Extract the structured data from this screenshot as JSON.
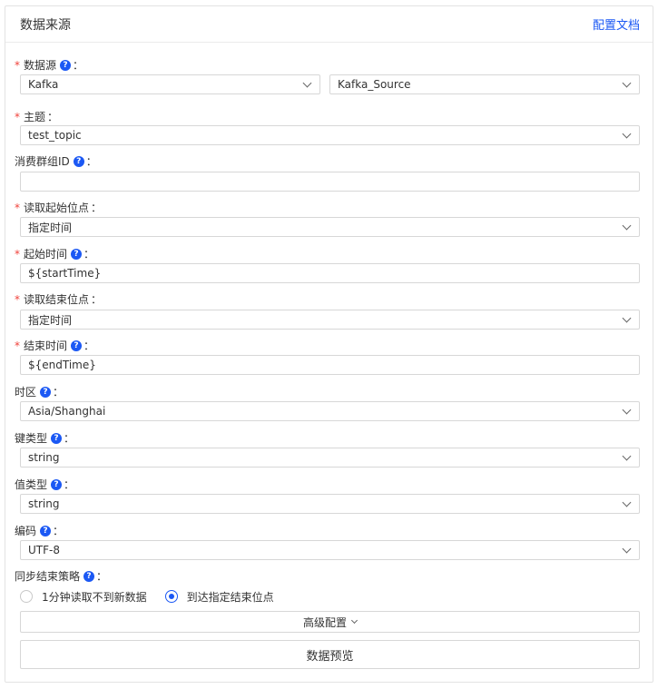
{
  "panel": {
    "title": "数据来源",
    "doc_link": "配置文档"
  },
  "fields": {
    "datasource": {
      "label": "数据源",
      "type_value": "Kafka",
      "source_value": "Kafka_Source"
    },
    "topic": {
      "label": "主题",
      "value": "test_topic"
    },
    "consumer_group": {
      "label": "消费群组ID",
      "value": ""
    },
    "read_start": {
      "label": "读取起始位点",
      "value": "指定时间"
    },
    "start_time": {
      "label": "起始时间",
      "value": "${startTime}"
    },
    "read_end": {
      "label": "读取结束位点",
      "value": "指定时间"
    },
    "end_time": {
      "label": "结束时间",
      "value": "${endTime}"
    },
    "timezone": {
      "label": "时区",
      "value": "Asia/Shanghai"
    },
    "key_type": {
      "label": "键类型",
      "value": "string"
    },
    "value_type": {
      "label": "值类型",
      "value": "string"
    },
    "encoding": {
      "label": "编码",
      "value": "UTF-8"
    },
    "sync_end": {
      "label": "同步结束策略",
      "options": [
        "1分钟读取不到新数据",
        "到达指定结束位点"
      ],
      "selected_index": 1
    }
  },
  "buttons": {
    "advanced": "高级配置",
    "preview": "数据预览"
  },
  "colon": "：",
  "required_mark": "*",
  "help_glyph": "?",
  "accent_color": "#1b58f4",
  "required_color": "#f0423b"
}
